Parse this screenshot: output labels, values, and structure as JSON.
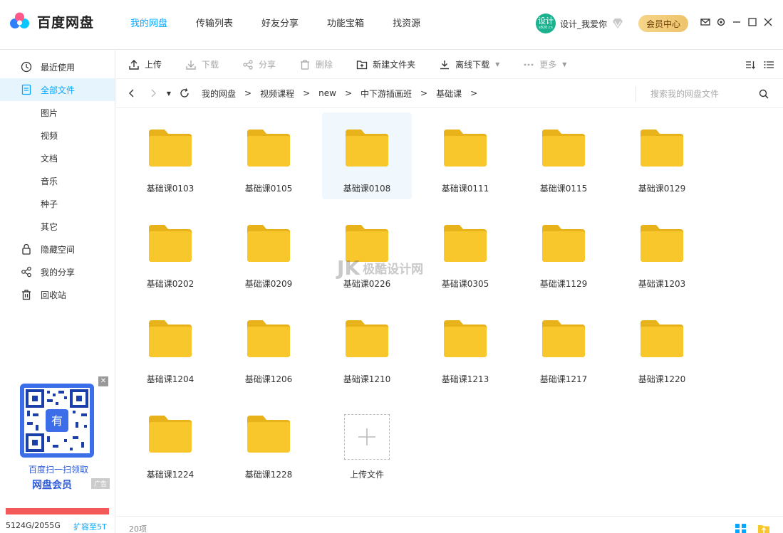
{
  "app": {
    "title": "百度网盘",
    "brand_color": "#06a7ff"
  },
  "nav": {
    "items": [
      {
        "label": "我的网盘",
        "active": true
      },
      {
        "label": "传输列表"
      },
      {
        "label": "好友分享"
      },
      {
        "label": "功能宝箱"
      },
      {
        "label": "找资源"
      }
    ]
  },
  "user": {
    "avatar_text": "设计",
    "avatar_sub": "s820.cn",
    "name": "设计_我爱你",
    "vip_label": "会员中心"
  },
  "sidebar": {
    "items": [
      {
        "label": "最近使用",
        "icon": "clock-icon"
      },
      {
        "label": "全部文件",
        "icon": "file-list-icon",
        "active": true
      },
      {
        "label": "图片",
        "sub": true
      },
      {
        "label": "视频",
        "sub": true
      },
      {
        "label": "文档",
        "sub": true
      },
      {
        "label": "音乐",
        "sub": true
      },
      {
        "label": "种子",
        "sub": true
      },
      {
        "label": "其它",
        "sub": true
      },
      {
        "label": "隐藏空间",
        "icon": "lock-icon"
      },
      {
        "label": "我的分享",
        "icon": "share-icon"
      },
      {
        "label": "回收站",
        "icon": "trash-icon"
      }
    ],
    "ad": {
      "line1": "百度扫一扫领取",
      "line2": "网盘会员",
      "tag": "广告",
      "qr_center": "有"
    },
    "quota": {
      "text": "5124G/2055G",
      "upgrade": "扩容至5T",
      "bar_color": "#f4595a"
    }
  },
  "toolbar": {
    "upload": "上传",
    "download": "下载",
    "share": "分享",
    "delete": "删除",
    "new_folder": "新建文件夹",
    "offline": "离线下载",
    "more": "更多"
  },
  "path": {
    "crumbs": [
      "我的网盘",
      "视频课程",
      "new",
      "中下游插画班",
      "基础课"
    ],
    "search_placeholder": "搜索我的网盘文件"
  },
  "files": [
    "基础课0103",
    "基础课0105",
    "基础课0108",
    "基础课0111",
    "基础课0115",
    "基础课0129",
    "基础课0202",
    "基础课0209",
    "基础课0226",
    "基础课0305",
    "基础课1129",
    "基础课1203",
    "基础课1204",
    "基础课1206",
    "基础课1210",
    "基础课1213",
    "基础课1217",
    "基础课1220",
    "基础课1224",
    "基础课1228"
  ],
  "upload_tile": "上传文件",
  "watermark": {
    "mark": "JK",
    "text": "极酷设计网"
  },
  "status": {
    "count": "20项"
  }
}
